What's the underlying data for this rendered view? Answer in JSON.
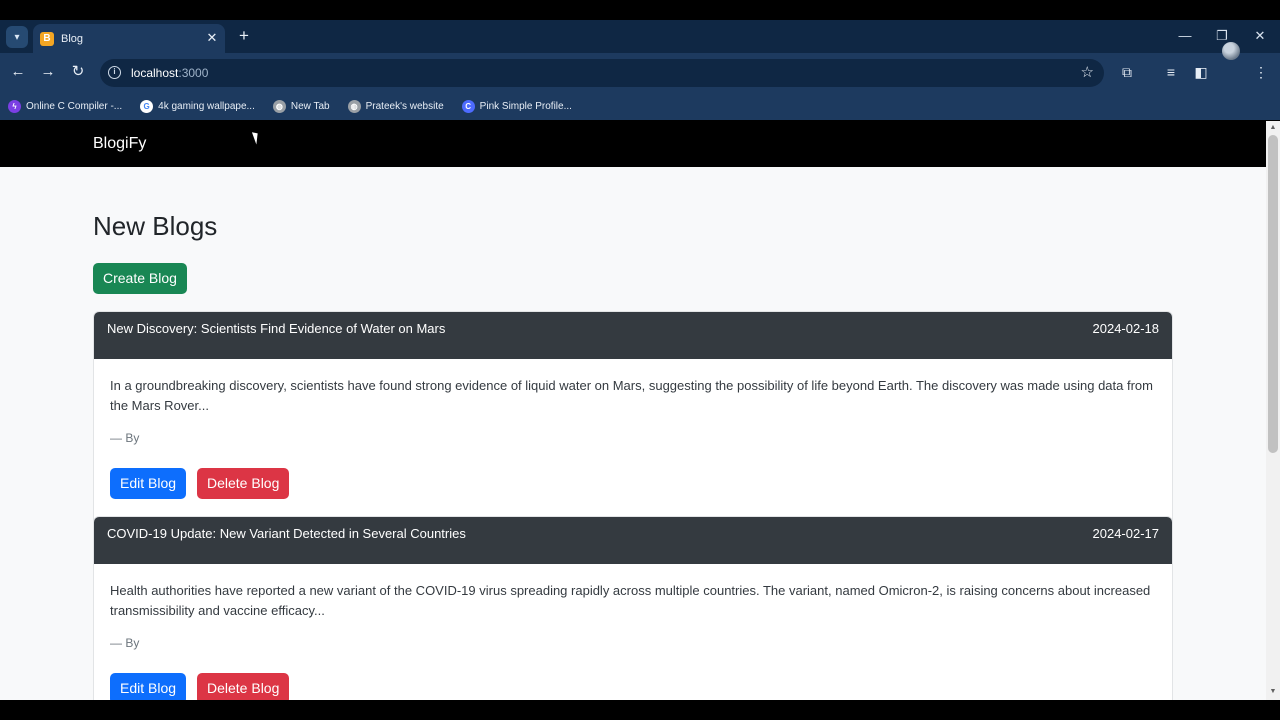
{
  "browser": {
    "tab_title": "Blog",
    "url_host": "localhost",
    "url_port": ":3000",
    "bookmarks": [
      {
        "label": "Online C Compiler -...",
        "icon": "bolt-icon",
        "color": "#7b3fe4"
      },
      {
        "label": "4k gaming wallpape...",
        "icon": "google-icon",
        "color": "#ffffff"
      },
      {
        "label": "New Tab",
        "icon": "globe-icon",
        "color": "#9aa0a6"
      },
      {
        "label": "Prateek's website",
        "icon": "globe-icon",
        "color": "#9aa0a6"
      },
      {
        "label": "Pink Simple Profile...",
        "icon": "canva-icon",
        "color": "#4d6bfe"
      }
    ]
  },
  "app": {
    "brand": "BlogiFy",
    "page_title": "New Blogs",
    "create_label": "Create Blog",
    "colors": {
      "navbar": "#000000",
      "card_header": "#343a40",
      "create": "#198754",
      "edit": "#0d6efd",
      "delete": "#dc3545"
    }
  },
  "blogs": [
    {
      "title": "New Discovery: Scientists Find Evidence of Water on Mars",
      "date": "2024-02-18",
      "excerpt": "In a groundbreaking discovery, scientists have found strong evidence of liquid water on Mars, suggesting the possibility of life beyond Earth. The discovery was made using data from the Mars Rover...",
      "author": "— By",
      "edit_label": "Edit Blog",
      "delete_label": "Delete Blog"
    },
    {
      "title": "COVID-19 Update: New Variant Detected in Several Countries",
      "date": "2024-02-17",
      "excerpt": "Health authorities have reported a new variant of the COVID-19 virus spreading rapidly across multiple countries. The variant, named Omicron-2, is raising concerns about increased transmissibility and vaccine efficacy...",
      "author": "— By",
      "edit_label": "Edit Blog",
      "delete_label": "Delete Blog"
    }
  ]
}
